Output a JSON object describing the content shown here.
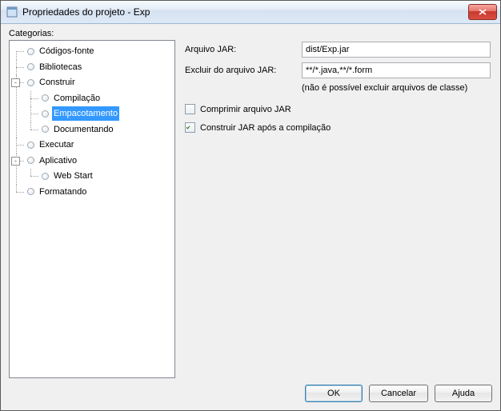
{
  "window": {
    "title": "Propriedades do projeto - Exp"
  },
  "categories": {
    "label": "Categorias:",
    "items": {
      "codigos_fonte": "Códigos-fonte",
      "bibliotecas": "Bibliotecas",
      "construir": "Construir",
      "compilacao": "Compilação",
      "empacotamento": "Empacotamento",
      "documentando": "Documentando",
      "executar": "Executar",
      "aplicativo": "Aplicativo",
      "web_start": "Web Start",
      "formatando": "Formatando"
    }
  },
  "form": {
    "arquivo_jar_label": "Arquivo JAR:",
    "arquivo_jar_value": "dist/Exp.jar",
    "excluir_label": "Excluir do arquivo JAR:",
    "excluir_value": "**/*.java,**/*.form",
    "note": "(não é possível excluir arquivos de classe)",
    "comprimir_label": "Comprimir arquivo JAR",
    "construir_jar_label": "Construir JAR após a compilação"
  },
  "buttons": {
    "ok": "OK",
    "cancelar": "Cancelar",
    "ajuda": "Ajuda"
  }
}
